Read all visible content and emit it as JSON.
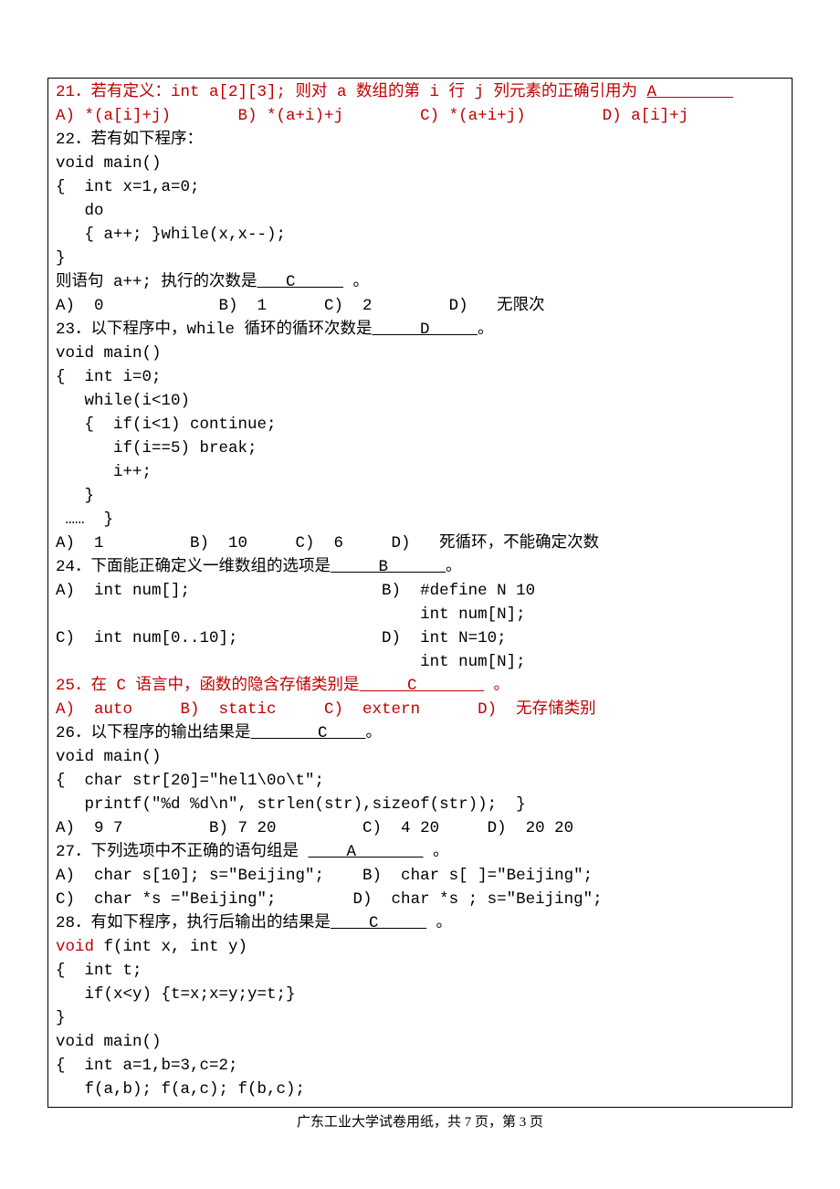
{
  "q21": {
    "stem_a": "21．若有定义：int a[2][3]; 则对 a 数组的第 i 行 j 列元素的正确引用为 ",
    "ans": "A        ",
    "optA": "A) *(a[i]+j)       ",
    "optB": "B) *(a+i)+j        ",
    "optC": "C) *(a+i+j)        ",
    "optD": "D) a[i]+j"
  },
  "q22": {
    "stem": "22．若有如下程序：",
    "c1": "void main()",
    "c2": "{  int x=1,a=0;",
    "c3": "   do",
    "c4": "   { a++; }while(x,x--);",
    "c5": "}",
    "tail_a": "则语句 a++; 执行的次数是",
    "ans": "   C     ",
    "tail_b": " 。",
    "opts": "A)  0            B)  1      C)  2        D)   无限次"
  },
  "q23": {
    "stem_a": "23．以下程序中，while 循环的循环次数是",
    "ans": "     D     ",
    "stem_b": "。",
    "c1": "void main()",
    "c2": "{  int i=0;",
    "c3": "   while(i<10)",
    "c4": "   {  if(i<1) continue;",
    "c5": "      if(i==5) break;",
    "c6": "      i++;",
    "c7": "   }",
    "c8": " ……  }",
    "opts": "A)  1         B)  10     C)  6     D)   死循环，不能确定次数"
  },
  "q24": {
    "stem_a": "24．下面能正确定义一维数组的选项是",
    "ans": "     B      ",
    "stem_b": "。",
    "row1": "A)  int num[];                    B)  #define N 10",
    "row2": "                                      int num[N];",
    "row3": "C)  int num[0..10];               D)  int N=10;",
    "row4": "                                      int num[N];"
  },
  "q25": {
    "stem_a": "25．在 C 语言中，函数的隐含存储类别是",
    "ans": "     C       ",
    "stem_b": " 。",
    "opts": "A)  auto     B)  static     C)  extern      D)  无存储类别"
  },
  "q26": {
    "stem_a": "26．以下程序的输出结果是",
    "ans": "       C    ",
    "stem_b": "。",
    "c1": "void main()",
    "c2": "{  char str[20]=\"hel1\\0o\\t\";",
    "c3": "   printf(\"%d %d\\n\", strlen(str),sizeof(str));  }",
    "opts": "A)  9 7         B) 7 20         C)  4 20     D)  20 20"
  },
  "q27": {
    "stem_a": "27．下列选项中不正确的语句组是 ",
    "ans": "    A       ",
    "stem_b": " 。",
    "row1": "A)  char s[10]; s=\"Beijing\";    B)  char s[ ]=\"Beijing\";",
    "row2": "C)  char *s =\"Beijing\";        D)  char *s ; s=\"Beijing\";"
  },
  "q28": {
    "stem_a": "28．有如下程序，执行后输出的结果是",
    "ans": "    C     ",
    "stem_b": " 。",
    "c1a": "void",
    "c1b": " f(int x, int y)",
    "c2": "{  int t;",
    "c3": "   if(x<y) {t=x;x=y;y=t;}",
    "c4": "}",
    "c5": "void main()",
    "c6": "{  int a=1,b=3,c=2;",
    "c7": "   f(a,b); f(a,c); f(b,c);"
  },
  "footer": "广东工业大学试卷用纸，共 7 页，第 3  页"
}
